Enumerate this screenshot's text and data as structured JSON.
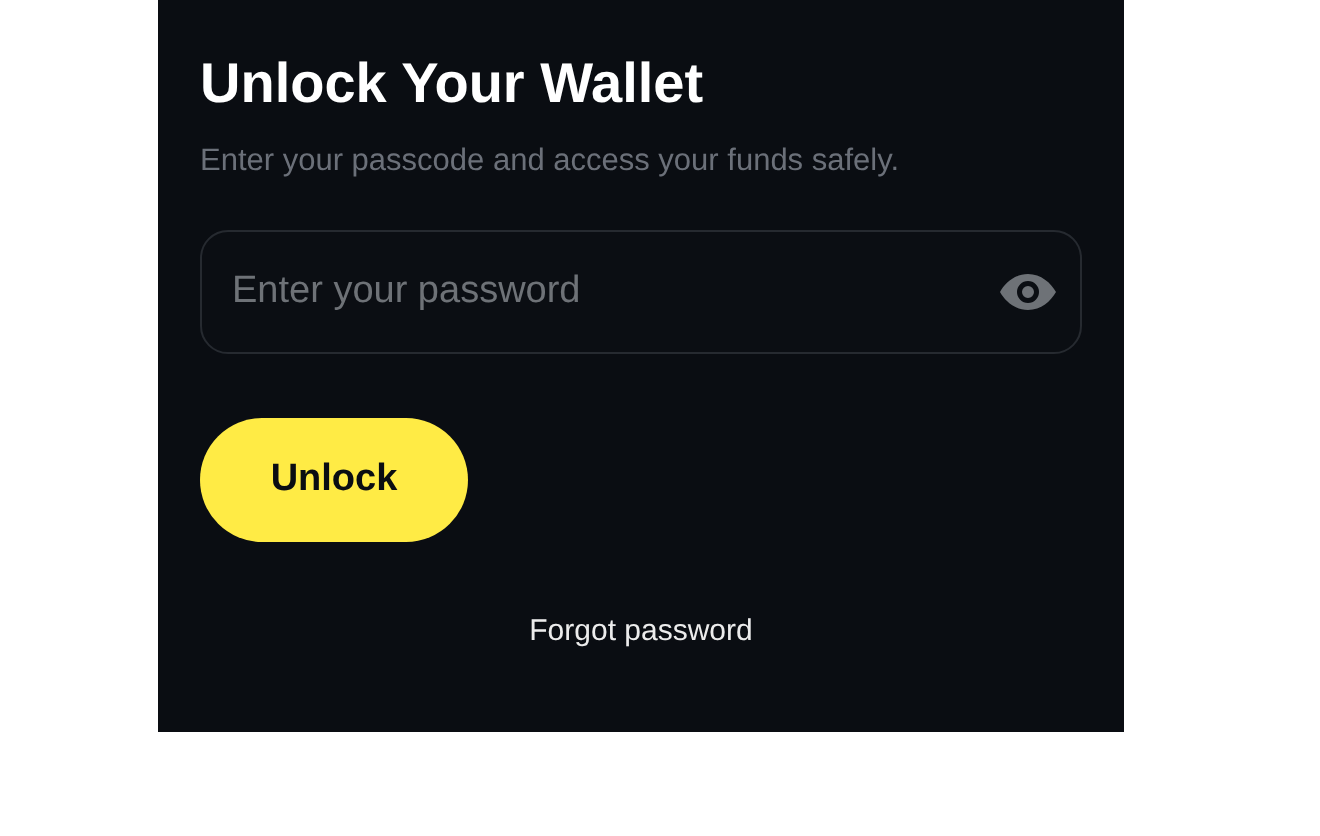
{
  "title": "Unlock Your Wallet",
  "subtitle": "Enter your passcode and access your funds safely.",
  "password_field": {
    "placeholder": "Enter your password"
  },
  "unlock_button": "Unlock",
  "forgot_link": "Forgot password"
}
